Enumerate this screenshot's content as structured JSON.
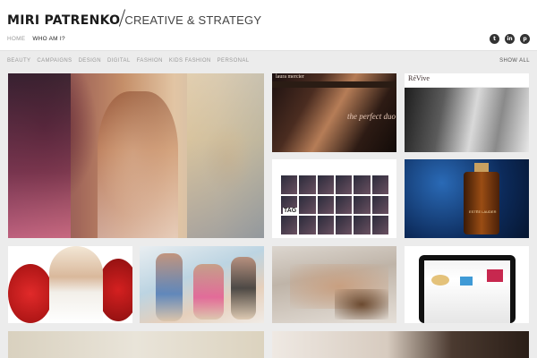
{
  "header": {
    "logo_name": "MIRI PATRENKO",
    "logo_tagline": "CREATIVE & STRATEGY",
    "nav": [
      {
        "label": "HOME",
        "active": false
      },
      {
        "label": "WHO AM I?",
        "active": true
      }
    ],
    "social": [
      {
        "icon": "twitter-icon",
        "glyph": "t"
      },
      {
        "icon": "linkedin-icon",
        "glyph": "in"
      },
      {
        "icon": "pinterest-icon",
        "glyph": "p"
      }
    ]
  },
  "filters": {
    "items": [
      "BEAUTY",
      "CAMPAIGNS",
      "DESIGN",
      "DIGITAL",
      "FASHION",
      "KIDS FASHION",
      "PERSONAL"
    ],
    "show_all": "SHOW ALL"
  },
  "tiles": {
    "laura_brand": "laura mercier",
    "laura_headline": "the perfect duo",
    "revive_brand": "RéVive",
    "tag_text": "TAG",
    "estee_text": "ESTĒE LAUDER"
  },
  "colors": {
    "header_bg": "#ffffff",
    "page_bg": "#ececec",
    "text_dark": "#222222",
    "text_muted": "#9a9a9a"
  }
}
